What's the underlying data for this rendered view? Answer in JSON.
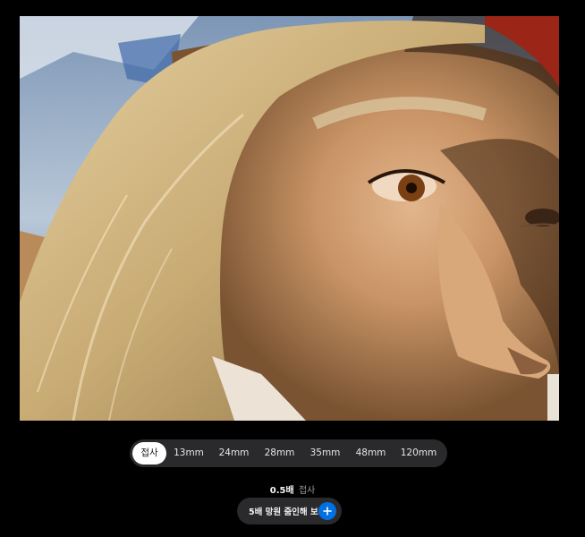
{
  "photo": {
    "description_icon": "portrait-photo"
  },
  "focal_lengths": {
    "items": [
      "접사",
      "13mm",
      "24mm",
      "28mm",
      "35mm",
      "48mm",
      "120mm"
    ],
    "selected_index": 0
  },
  "caption": {
    "zoom_value": "0.5배",
    "mode": "접사"
  },
  "zoom_button": {
    "label": "5배 망원 줌인해 보기",
    "icon": "plus-icon",
    "accent": "#0071e3"
  },
  "colors": {
    "background": "#000000",
    "control_bg": "#2a2a2d",
    "active_segment": "#ffffff"
  }
}
